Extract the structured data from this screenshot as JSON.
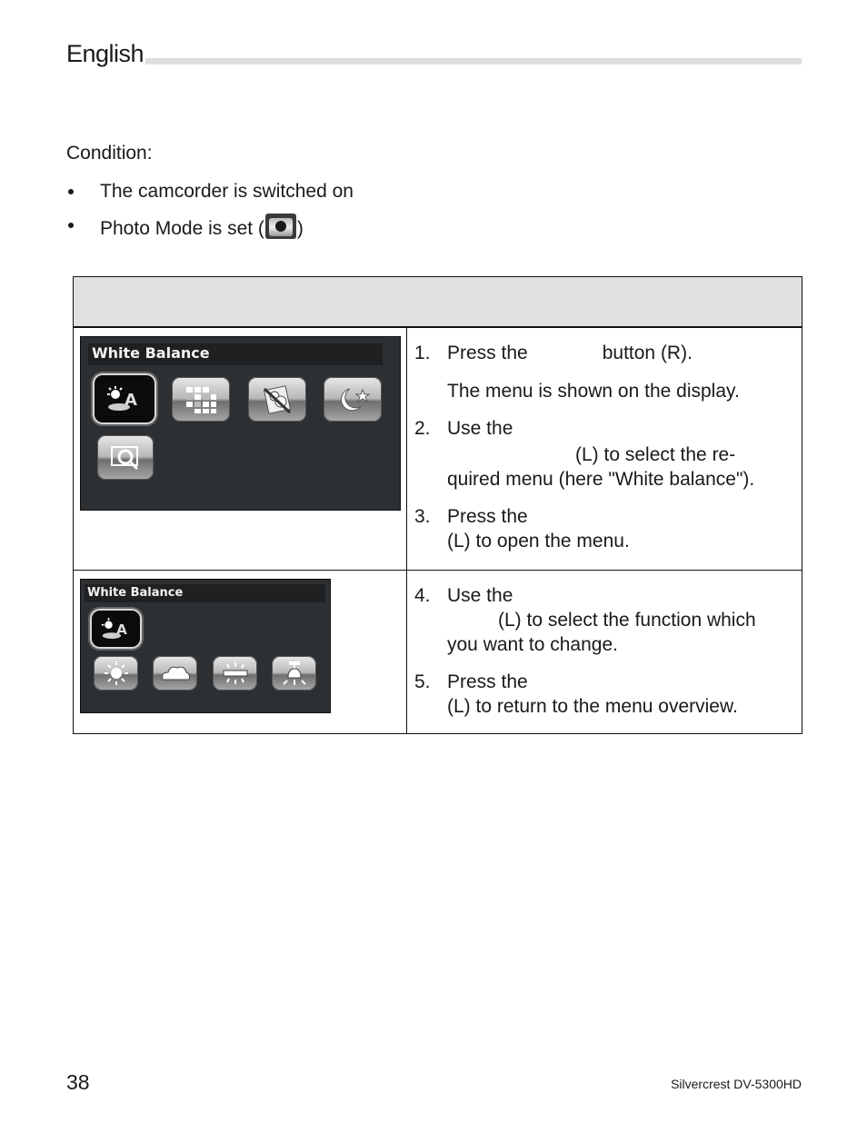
{
  "header": {
    "title": "English"
  },
  "condition": {
    "label": "Condition:",
    "items": [
      {
        "text": "The camcorder is switched on"
      },
      {
        "text_before": "Photo Mode is set (",
        "icon": "photo-mode-camera-icon",
        "text_after": ")"
      }
    ]
  },
  "table": {
    "header_text": "",
    "rows": [
      {
        "screen": {
          "title": "White Balance",
          "icons": [
            "auto-white-balance-icon",
            "grid-icon",
            "no-flash-portrait-icon",
            "night-scene-icon",
            "zoom-preview-icon"
          ],
          "selected_index": 0
        },
        "steps": [
          {
            "num": "1.",
            "text_a": "Press the",
            "text_b": "button (R).",
            "note": "The menu is shown on the display."
          },
          {
            "num": "2.",
            "line1": "Use the",
            "line2": "(L) to select the re-",
            "line3": "quired menu (here \"White balance\")."
          },
          {
            "num": "3.",
            "line1": "Press the",
            "line2": "(L) to open the menu."
          }
        ]
      },
      {
        "screen": {
          "title": "White Balance",
          "icons": [
            "auto-white-balance-icon",
            "daylight-sun-icon",
            "cloudy-icon",
            "fluorescent-icon",
            "tungsten-lamp-icon"
          ],
          "selected_index": 0
        },
        "steps": [
          {
            "num": "4.",
            "line1": "Use the",
            "line2": "(L) to select the function which",
            "line3": "you want to change."
          },
          {
            "num": "5.",
            "line1": "Press the",
            "line2": "(L) to return to the menu overview."
          }
        ]
      }
    ]
  },
  "footer": {
    "page_number": "38",
    "model": "Silvercrest DV-5300HD"
  }
}
